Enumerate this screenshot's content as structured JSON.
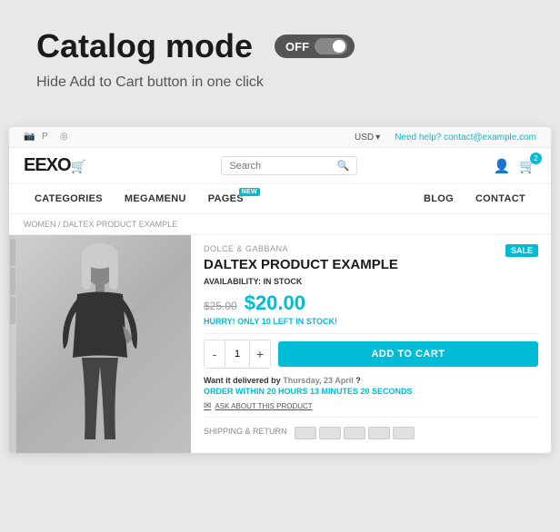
{
  "header": {
    "title": "Catalog mode",
    "subtitle": "Hide Add to Cart button in one click",
    "toggle_label": "OFF"
  },
  "topbar": {
    "currency": "USD",
    "currency_arrow": "▾",
    "need_help": "Need help?",
    "contact_email": "contact@example.com"
  },
  "navbar": {
    "logo": "EEXO",
    "search_placeholder": "Search",
    "cart_count": "2"
  },
  "menu": {
    "items_left": [
      "CATEGORIES",
      "MEGAMENU",
      "PAGES"
    ],
    "items_right": [
      "BLOG",
      "CONTACT"
    ],
    "new_badge": "NEW"
  },
  "breadcrumb": {
    "path": "WOMEN / DALTEX PRODUCT EXAMPLE"
  },
  "product": {
    "brand": "DOLCE & GABBANA",
    "sale_badge": "SALE",
    "title": "DALTEX PRODUCT EXAMPLE",
    "availability_label": "AVAILABILITY:",
    "availability_status": "IN STOCK",
    "old_price": "$25.00",
    "new_price": "$20.00",
    "hurry_prefix": "HURRY!",
    "hurry_text": "ONLY 10 LEFT IN STOCK!",
    "qty": "1",
    "add_to_cart": "ADD TO CART",
    "delivery_label": "Want it delivered by",
    "delivery_date": "Thursday, 23 April",
    "delivery_suffix": "?",
    "order_prefix": "Order within",
    "order_time": "20 HOURS 13 MINUTES 20 SECONDS",
    "ask_link": "ASK ABOUT THIS PRODUCT",
    "shipping_label": "SHIPPING & RETURN"
  }
}
